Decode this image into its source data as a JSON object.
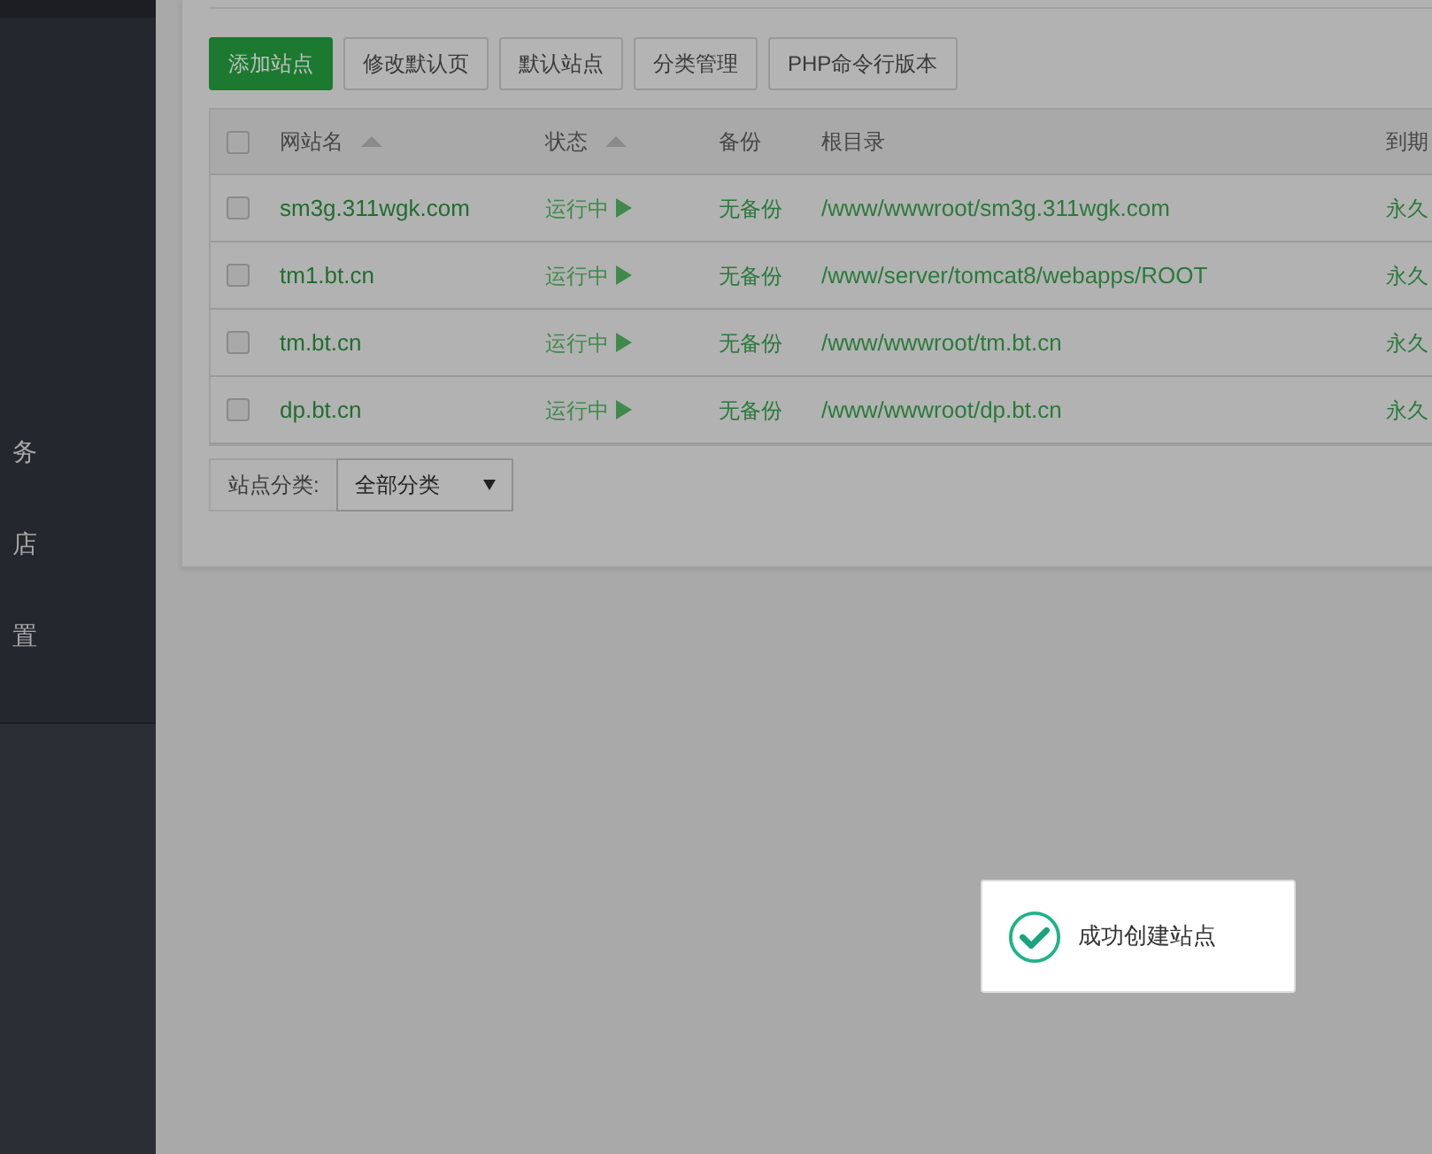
{
  "sidebar": {
    "items": [
      {
        "label": "务"
      },
      {
        "label": "店"
      },
      {
        "label": "置"
      }
    ]
  },
  "toolbar": {
    "buttons": [
      {
        "label": "添加站点",
        "kind": "primary"
      },
      {
        "label": "修改默认页",
        "kind": "default"
      },
      {
        "label": "默认站点",
        "kind": "default"
      },
      {
        "label": "分类管理",
        "kind": "default"
      },
      {
        "label": "PHP命令行版本",
        "kind": "default"
      }
    ]
  },
  "table": {
    "select_all": {
      "checked": false
    },
    "columns": [
      {
        "label": "网站名",
        "sortable": true
      },
      {
        "label": "状态",
        "sortable": true
      },
      {
        "label": "备份",
        "sortable": false
      },
      {
        "label": "根目录",
        "sortable": false
      },
      {
        "label": "到期",
        "sortable": false
      }
    ],
    "rows": [
      {
        "checked": false,
        "name": "sm3g.311wgk.com",
        "status": "运行中",
        "running": true,
        "backup": "无备份",
        "root": "/www/wwwroot/sm3g.311wgk.com",
        "expiry": "永久"
      },
      {
        "checked": false,
        "name": "tm1.bt.cn",
        "status": "运行中",
        "running": true,
        "backup": "无备份",
        "root": "/www/server/tomcat8/webapps/ROOT",
        "expiry": "永久"
      },
      {
        "checked": false,
        "name": "tm.bt.cn",
        "status": "运行中",
        "running": true,
        "backup": "无备份",
        "root": "/www/wwwroot/tm.bt.cn",
        "expiry": "永久"
      },
      {
        "checked": false,
        "name": "dp.bt.cn",
        "status": "运行中",
        "running": true,
        "backup": "无备份",
        "root": "/www/wwwroot/dp.bt.cn",
        "expiry": "永久"
      }
    ]
  },
  "category_filter": {
    "label": "站点分类:",
    "value": "全部分类"
  },
  "toast": {
    "message": "成功创建站点"
  }
}
